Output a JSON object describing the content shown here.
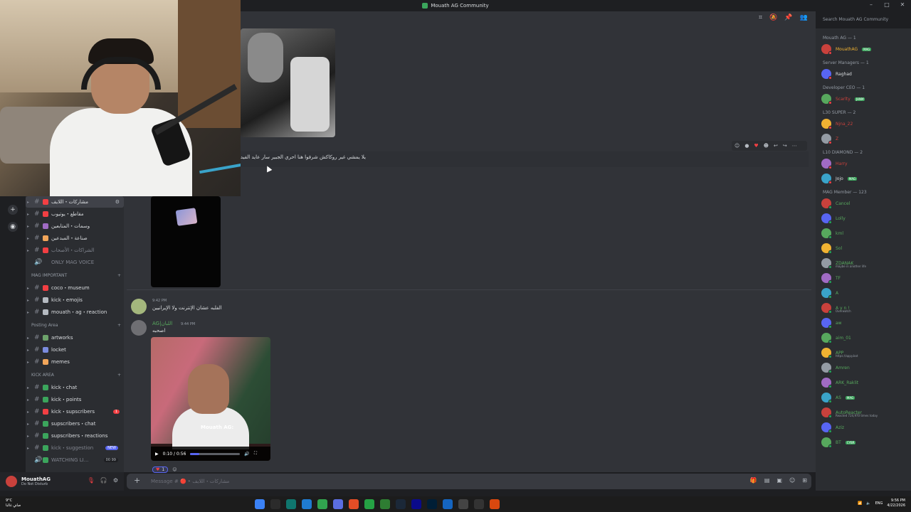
{
  "window": {
    "title": "Mouath AG Community",
    "controls": [
      "–",
      "□",
      "✕"
    ]
  },
  "toolbar": {
    "search_placeholder": "Search Mouath AG Community"
  },
  "channels": {
    "items": [
      {
        "name": "مشاركات・اللايف",
        "emoji_color": "#f23f43",
        "selected": true
      },
      {
        "name": "مقاطع・يوتيوب",
        "emoji_color": "#f23f43"
      },
      {
        "name": "وسمات・المتابعين",
        "emoji_color": "#a06bc4"
      },
      {
        "name": "صناعة・المبدعين",
        "emoji_color": "#f2a65a"
      },
      {
        "name": "الشراكات・الأصحاب",
        "emoji_color": "#f23f43",
        "muted": true
      },
      {
        "name": "ONLY MAG VOICE",
        "muted": true,
        "voice": true
      }
    ],
    "categories": [
      {
        "name": "MAG IMPORTANT",
        "items": [
          {
            "name": "coco・museum",
            "emoji_color": "#f23f43"
          },
          {
            "name": "kick・emojis",
            "emoji_color": "#b5bac1"
          },
          {
            "name": "mouath・ag・reaction",
            "emoji_color": "#b5bac1"
          }
        ]
      },
      {
        "name": "Posting Area",
        "items": [
          {
            "name": "artworks",
            "emoji_color": "#6da36b"
          },
          {
            "name": "locket",
            "emoji_color": "#7b8cde"
          },
          {
            "name": "memes",
            "emoji_color": "#f2a65a"
          }
        ]
      },
      {
        "name": "KICK AREA",
        "items": [
          {
            "name": "kick・chat",
            "emoji_color": "#3ba55c"
          },
          {
            "name": "kick・points",
            "emoji_color": "#3ba55c"
          },
          {
            "name": "kick・supscribers",
            "emoji_color": "#f23f43",
            "badge": "1"
          },
          {
            "name": "supscribers・chat",
            "emoji_color": "#3ba55c"
          },
          {
            "name": "supscribers・reactions",
            "emoji_color": "#3ba55c"
          },
          {
            "name": "kick・suggestion",
            "emoji_color": "#3ba55c",
            "muted": true,
            "badge_new": "NEW"
          },
          {
            "name": "WATCHING LI...",
            "emoji_color": "#3ba55c",
            "muted": true,
            "voice": true,
            "count": "00  99"
          }
        ]
      }
    ]
  },
  "user": {
    "name": "MouathAG",
    "status": "Do Not Disturb"
  },
  "messages": [
    {
      "text": "يلا يمشي غير روكاكش شرفوا هنا احري الجبير سار عايد الفيديوهات الد"
    },
    {
      "time": "9:42 PM",
      "text": "الفلبه عشان الإنترنت ولا الإيرانيين"
    },
    {
      "username": "AG|اللبان",
      "time": "9:44 PM",
      "text": "اصحبه"
    }
  ],
  "video": {
    "caption": "Mouath AG:",
    "time_display": "0:10 / 0:56",
    "progress": 0.18
  },
  "reactions": [
    {
      "emoji": "heart",
      "count": "1"
    }
  ],
  "composer": {
    "placeholder": "Message # 🔴 ‣ مشاركات・اللايف"
  },
  "members": {
    "groups": [
      {
        "title": "Mouath AG — 1",
        "members": [
          {
            "name": "MouathAG",
            "color": "#f0b232",
            "tag": "MAG"
          }
        ]
      },
      {
        "title": "Server Managers — 1",
        "members": [
          {
            "name": "Raghad",
            "color": "#dbdee1"
          }
        ]
      },
      {
        "title": "Developer CEO — 1",
        "members": [
          {
            "name": "Scarlty",
            "color": "#c9413c",
            "tag": "JHNM"
          }
        ]
      },
      {
        "title": "L30 SUPER — 2",
        "members": [
          {
            "name": "Njna_22",
            "color": "#c9413c"
          },
          {
            "name": "Z",
            "color": "#c9413c"
          }
        ]
      },
      {
        "title": "L10 DIAMOND — 2",
        "members": [
          {
            "name": "Harry",
            "color": "#c9413c"
          },
          {
            "name": "Jojo",
            "color": "#dbdee1",
            "tag": "MAG"
          }
        ]
      },
      {
        "title": "MAG Member — 123",
        "members": [
          {
            "name": "Cancel",
            "color": "#57a85d"
          },
          {
            "name": "Lolly",
            "color": "#57a85d"
          },
          {
            "name": "kml",
            "color": "#57a85d"
          },
          {
            "name": "Sol",
            "color": "#57a85d"
          },
          {
            "name": "ZDANAK",
            "color": "#57a85d",
            "sub": "maybe in another life"
          },
          {
            "name": "TF",
            "color": "#57a85d"
          },
          {
            "name": "A",
            "color": "#57a85d"
          },
          {
            "name": "A y n ! ",
            "color": "#57a85d",
            "sub": "Overwatch"
          },
          {
            "name": "aw",
            "color": "#57a85d"
          },
          {
            "name": "aim_01",
            "color": "#57a85d"
          },
          {
            "name": "APP",
            "color": "#57a85d",
            "sub": "https://appy.bot"
          },
          {
            "name": "Amren",
            "color": "#57a85d"
          },
          {
            "name": "ARK_Raklit",
            "color": "#57a85d"
          },
          {
            "name": "AS",
            "color": "#57a85d",
            "tag": "MAG"
          },
          {
            "name": "AutoReacter",
            "color": "#57a85d",
            "sub": "Reacted 724,970 times today"
          },
          {
            "name": "Aziz",
            "color": "#57a85d"
          },
          {
            "name": "BT",
            "color": "#57a85d",
            "tag": "CYBR"
          }
        ]
      }
    ]
  },
  "taskbar": {
    "weather": "9°C",
    "weather_sub": "صافٍ غالبا",
    "lang": "ENG",
    "time": "9:56 PM",
    "date": "4/22/2026"
  }
}
